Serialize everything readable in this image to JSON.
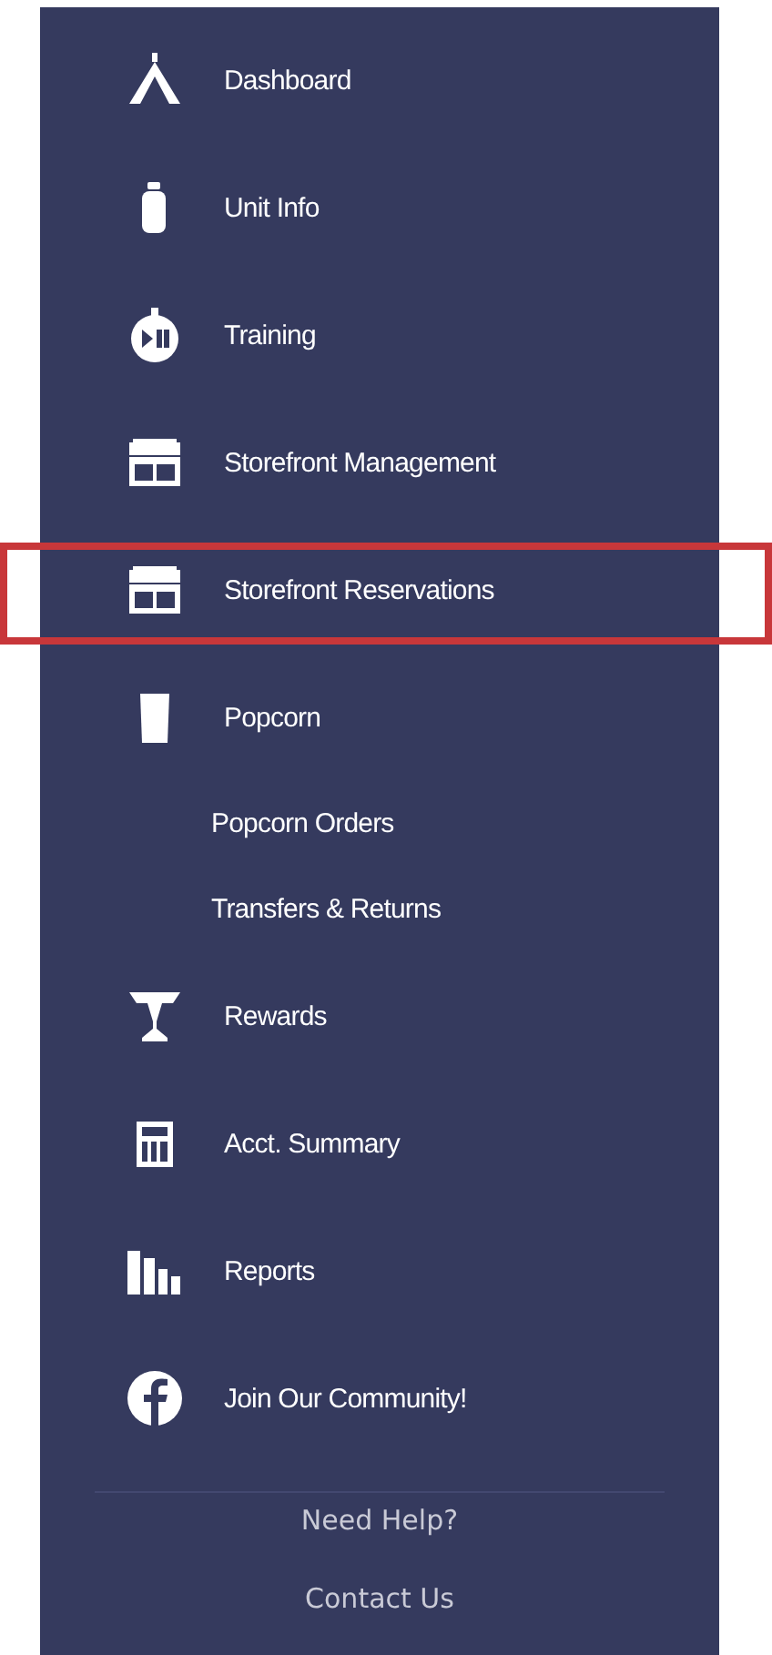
{
  "sidebar": {
    "items": [
      {
        "label": "Dashboard",
        "highlighted": false
      },
      {
        "label": "Unit Info",
        "highlighted": false
      },
      {
        "label": "Training",
        "highlighted": false
      },
      {
        "label": "Storefront Management",
        "highlighted": false
      },
      {
        "label": "Storefront Reservations",
        "highlighted": true
      },
      {
        "label": "Popcorn",
        "highlighted": false,
        "children": [
          {
            "label": "Popcorn Orders"
          },
          {
            "label": "Transfers & Returns"
          }
        ]
      },
      {
        "label": "Rewards",
        "highlighted": false
      },
      {
        "label": "Acct. Summary",
        "highlighted": false
      },
      {
        "label": "Reports",
        "highlighted": false
      },
      {
        "label": "Join Our Community!",
        "highlighted": false
      }
    ],
    "footer_links": [
      "Need Help?",
      "Contact Us"
    ]
  }
}
